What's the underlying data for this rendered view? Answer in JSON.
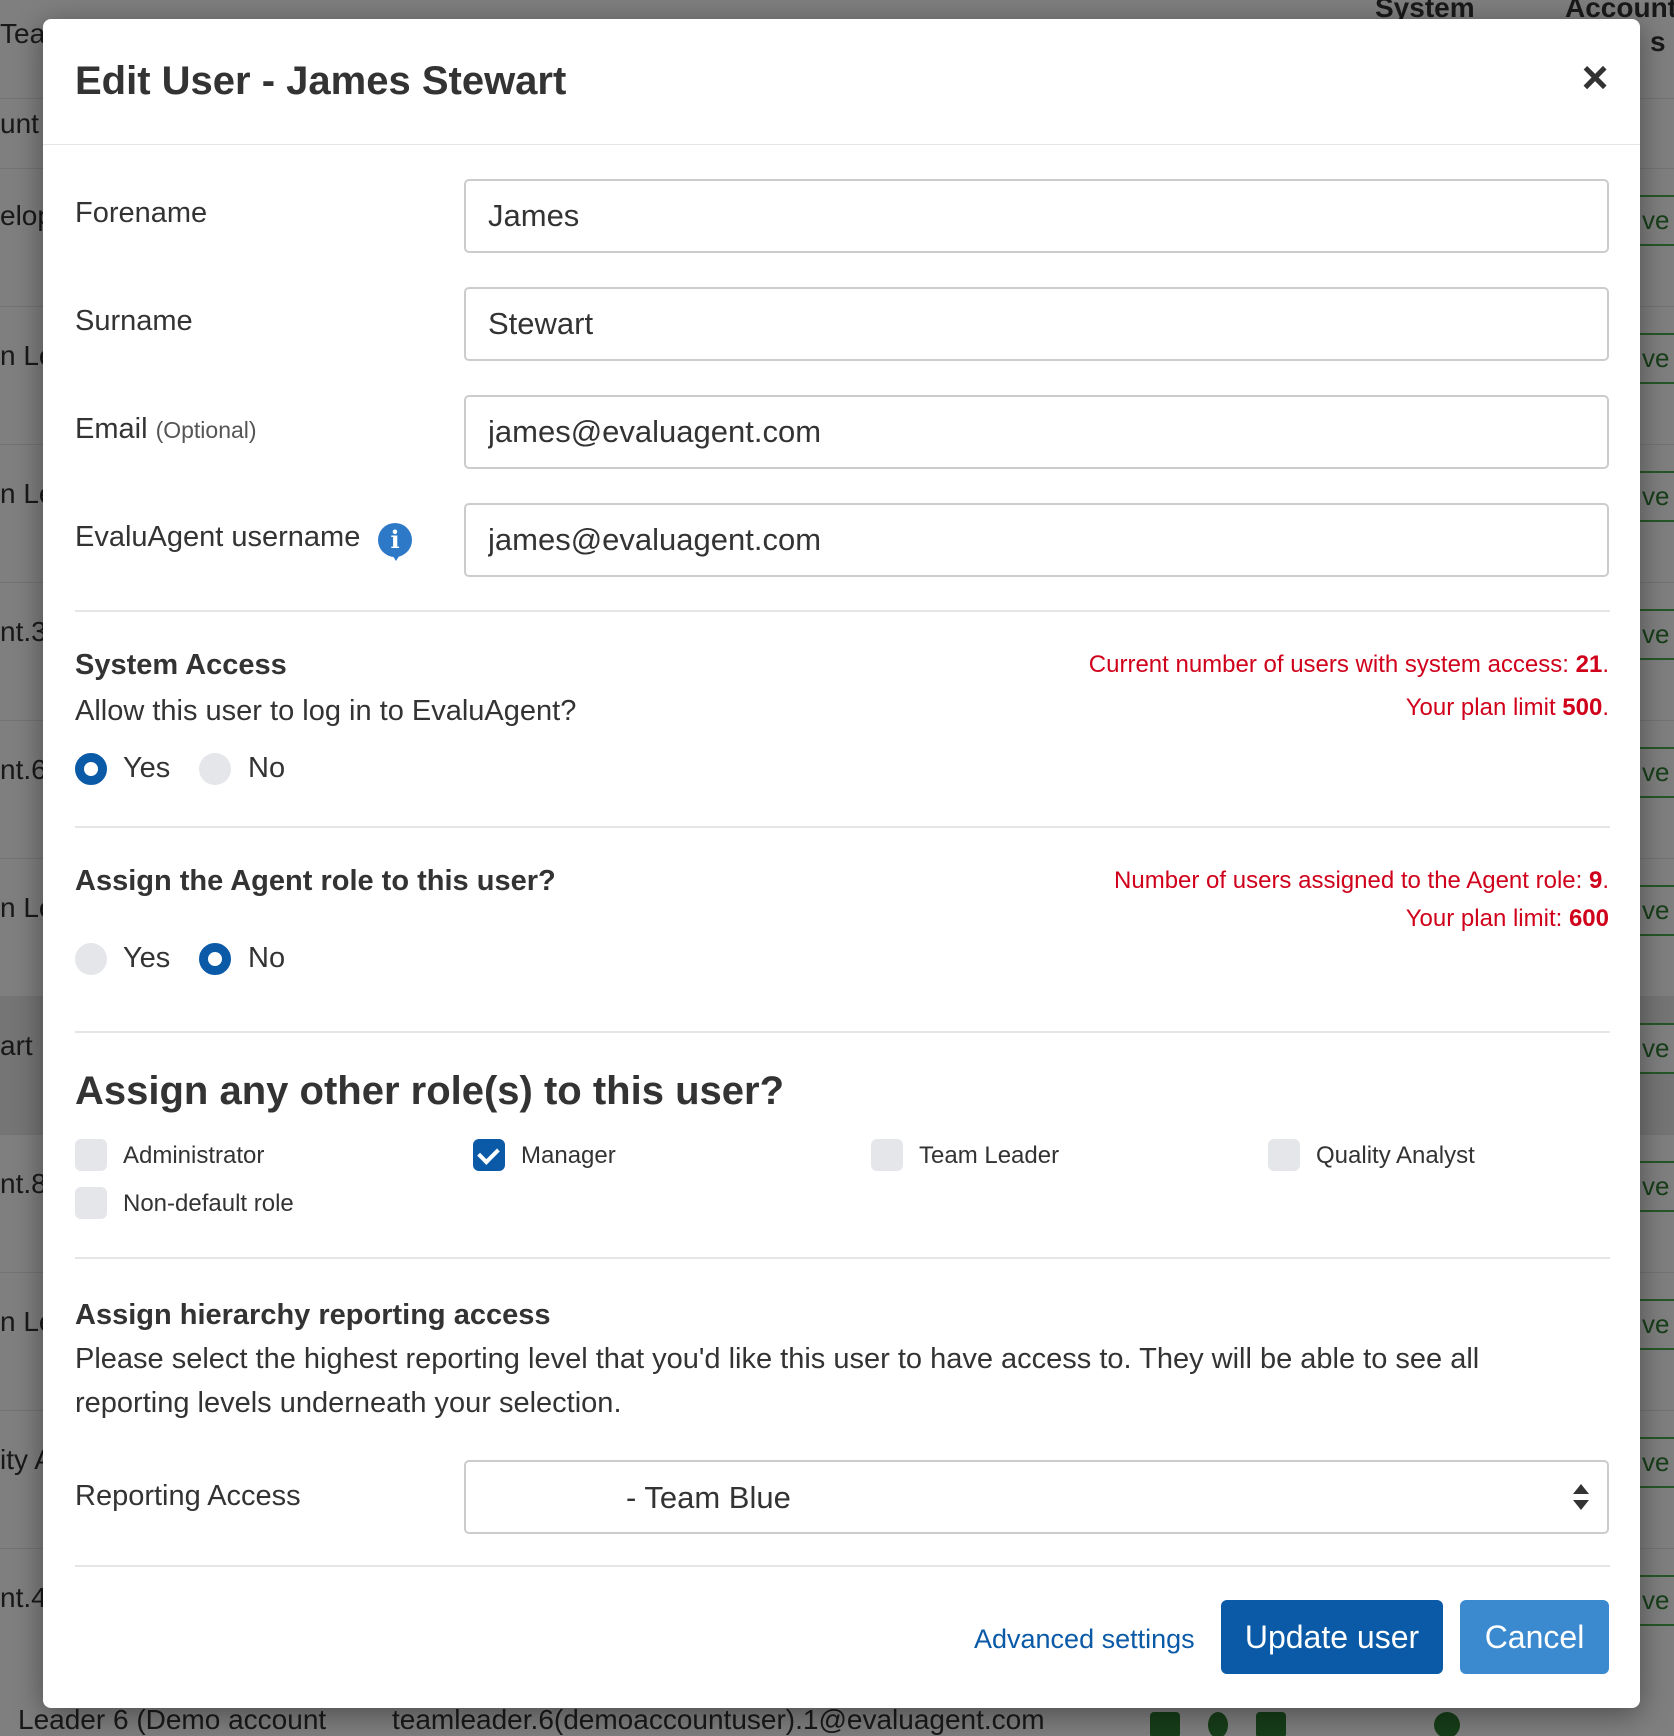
{
  "background": {
    "headers": [
      "System",
      "Account",
      "s"
    ],
    "rows": [
      {
        "left": "Team",
        "right": ""
      },
      {
        "left": "unt",
        "right": ""
      },
      {
        "left": "elop",
        "right": "ve"
      },
      {
        "left": "n Le",
        "right": "ve"
      },
      {
        "left": "n Le",
        "right": "ve"
      },
      {
        "left": "nt.3",
        "right": "ve"
      },
      {
        "left": "nt.6",
        "right": "ve"
      },
      {
        "left": "n Le",
        "right": "ve"
      },
      {
        "left": "art",
        "right": "ve"
      },
      {
        "left": "nt.8",
        "right": "ve"
      },
      {
        "left": "n Le",
        "right": "ve"
      },
      {
        "left": "ity A",
        "right": "ve"
      },
      {
        "left": "nt.4",
        "right": "ve"
      }
    ],
    "bottom_row_name": "Leader 6 (Demo account",
    "bottom_row_email": "teamleader.6(demoaccountuser).1@evaluagent.com"
  },
  "modal": {
    "title": "Edit User - James Stewart",
    "close_glyph": "×",
    "fields": {
      "forename": {
        "label": "Forename",
        "value": "James"
      },
      "surname": {
        "label": "Surname",
        "value": "Stewart"
      },
      "email": {
        "label": "Email",
        "label_note": "(Optional)",
        "value": "james@evaluagent.com"
      },
      "username": {
        "label": "EvaluAgent username",
        "value": "james@evaluagent.com"
      }
    },
    "info_glyph": "i",
    "system_access": {
      "title": "System Access",
      "question": "Allow this user to log in to EvaluAgent?",
      "yes": "Yes",
      "no": "No",
      "selected": "Yes",
      "count_text": "Current number of users with system access: ",
      "count": "21",
      "count_suffix": ".",
      "limit_text": "Your plan limit ",
      "limit": "500",
      "limit_suffix": "."
    },
    "agent_role": {
      "title": "Assign the Agent role to this user?",
      "yes": "Yes",
      "no": "No",
      "selected": "No",
      "count_text": "Number of users assigned to the Agent role: ",
      "count": "9",
      "count_suffix": ".",
      "limit_text": "Your plan limit: ",
      "limit": "600"
    },
    "other_roles": {
      "title": "Assign any other role(s) to this user?",
      "roles": [
        {
          "label": "Administrator",
          "checked": false
        },
        {
          "label": "Manager",
          "checked": true
        },
        {
          "label": "Team Leader",
          "checked": false
        },
        {
          "label": "Quality Analyst",
          "checked": false
        },
        {
          "label": "Non-default role",
          "checked": false
        }
      ]
    },
    "hierarchy": {
      "title": "Assign hierarchy reporting access",
      "description": "Please select the highest reporting level that you'd like this user to have access to. They will be able to see all reporting levels underneath your selection.",
      "reporting_label": "Reporting Access",
      "reporting_value": "- Team Blue"
    },
    "footer": {
      "advanced_link": "Advanced settings",
      "update_button": "Update user",
      "cancel_button": "Cancel"
    }
  },
  "colors": {
    "primary": "#0a5aa7",
    "secondary": "#3b8ad0",
    "warning_text": "#d0021b",
    "info_icon": "#2e79c7"
  }
}
